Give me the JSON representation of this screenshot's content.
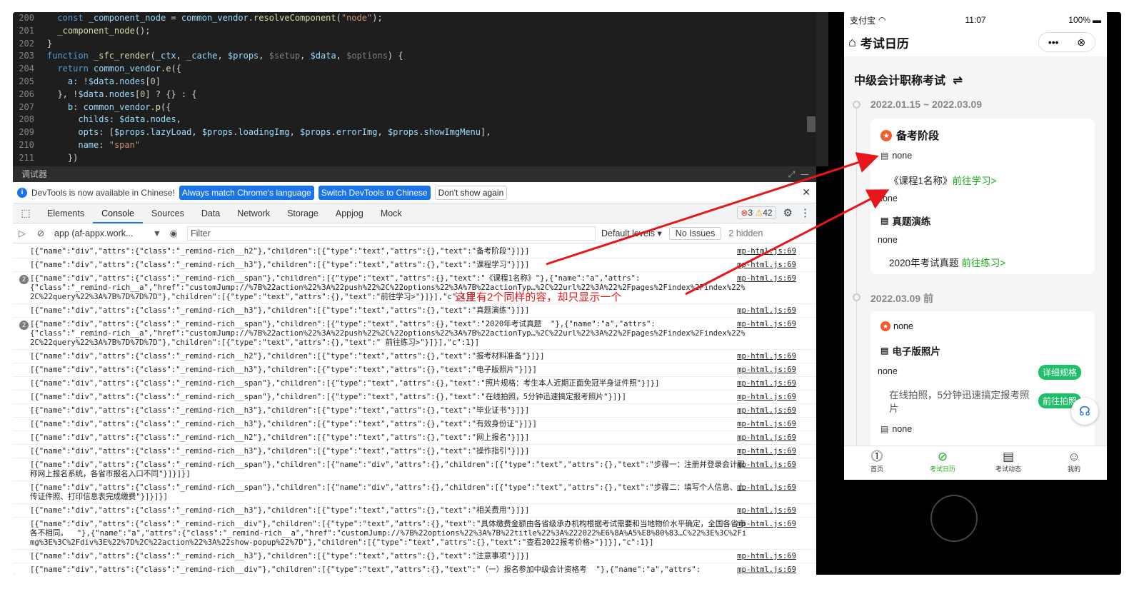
{
  "editor": {
    "lines": [
      {
        "n": "200",
        "html": "  <span class=\"kw\">const</span> <span class=\"var\">_component_node</span> = <span class=\"var\">common_vendor</span>.<span class=\"fn\">resolveComponent</span>(<span class=\"str\">\"node\"</span>);"
      },
      {
        "n": "201",
        "html": "  <span class=\"fn\">_component_node</span>();"
      },
      {
        "n": "202",
        "html": "}"
      },
      {
        "n": "203",
        "html": "<span class=\"kw\">function</span> <span class=\"fn\">_sfc_render</span>(<span class=\"pm\">_ctx</span>, <span class=\"pm\">_cache</span>, <span class=\"pm\">$props</span>, <span class=\"gray\">$setup</span>, <span class=\"pm\">$data</span>, <span class=\"gray\">$options</span>) {"
      },
      {
        "n": "204",
        "html": "  <span class=\"kw\">return</span> <span class=\"var\">common_vendor</span>.<span class=\"fn\">e</span>({"
      },
      {
        "n": "205",
        "html": "    <span class=\"var\">a</span>: !<span class=\"var\">$data</span>.<span class=\"var\">nodes</span>[<span class=\"num\">0</span>]"
      },
      {
        "n": "206",
        "html": "  }, !<span class=\"var\">$data</span>.<span class=\"var\">nodes</span>[<span class=\"num\">0</span>] ? {} : {"
      },
      {
        "n": "207",
        "html": "    <span class=\"var\">b</span>: <span class=\"var\">common_vendor</span>.<span class=\"fn\">p</span>({"
      },
      {
        "n": "208",
        "html": "      <span class=\"var\">childs</span>: <span class=\"var\">$data</span>.<span class=\"var\">nodes</span>,"
      },
      {
        "n": "209",
        "html": "      <span class=\"var\">opts</span>: [<span class=\"var\">$props</span>.<span class=\"var\">lazyLoad</span>, <span class=\"var\">$props</span>.<span class=\"var\">loadingImg</span>, <span class=\"var\">$props</span>.<span class=\"var\">errorImg</span>, <span class=\"var\">$props</span>.<span class=\"var\">showImgMenu</span>],"
      },
      {
        "n": "210",
        "html": "      <span class=\"var\">name</span>: <span class=\"str\">\"span\"</span>"
      },
      {
        "n": "211",
        "html": "    })"
      }
    ]
  },
  "debugger_label": "调试器",
  "devtools": {
    "info_text": "DevTools is now available in Chinese!",
    "btn_match": "Always match Chrome's language",
    "btn_switch": "Switch DevTools to Chinese",
    "btn_dont_show": "Don't show again",
    "tabs": [
      "Elements",
      "Console",
      "Sources",
      "Data",
      "Network",
      "Storage",
      "Appjog",
      "Mock"
    ],
    "errors": "3",
    "warnings": "42",
    "context": "app (af-appx.work...",
    "filter_placeholder": "Filter",
    "levels": "Default levels ▾",
    "no_issues": "No Issues",
    "hidden": "2 hidden"
  },
  "console": {
    "source": "mp-html.js:69",
    "rows": [
      {
        "badge": "",
        "text": "[{\"name\":\"div\",\"attrs\":{\"class\":\"_remind-rich__h2\"},\"children\":[{\"type\":\"text\",\"attrs\":{},\"text\":\"备考阶段\"}]}]"
      },
      {
        "badge": "",
        "text": "[{\"name\":\"div\",\"attrs\":{\"class\":\"_remind-rich__h3\"},\"children\":[{\"type\":\"text\",\"attrs\":{},\"text\":\"课程学习\"}]}]"
      },
      {
        "badge": "2",
        "text": "[{\"name\":\"div\",\"attrs\":{\"class\":\"_remind-rich__span\"},\"children\":[{\"type\":\"text\",\"attrs\":{},\"text\":\"《课程1名称》\"},{\"name\":\"a\",\"attrs\":\n{\"class\":\"_remind-rich__a\",\"href\":\"customJump://%7B%22action%22%3A%22push%22%2C%22options%22%3A%7B%22actionTyp…%2C%22url%22%3A%22%2Fpages%2Findex%2Findex%22%2C%22query%22%3A%7B%7D%7D%7D\"},\"children\":[{\"type\":\"text\",\"attrs\":{},\"text\":\"前往学习>\"}]}],\"c\":1}]"
      },
      {
        "badge": "",
        "text": "[{\"name\":\"div\",\"attrs\":{\"class\":\"_remind-rich__h3\"},\"children\":[{\"type\":\"text\",\"attrs\":{},\"text\":\"真题演练\"}]}]"
      },
      {
        "badge": "2",
        "text": "[{\"name\":\"div\",\"attrs\":{\"class\":\"_remind-rich__span\"},\"children\":[{\"type\":\"text\",\"attrs\":{},\"text\":\"2020年考试真题  \"},{\"name\":\"a\",\"attrs\":\n{\"class\":\"_remind-rich__a\",\"href\":\"customJump://%7B%22action%22%3A%22push%22%2C%22options%22%3A%7B%22actionTyp…%2C%22url%22%3A%22%2Fpages%2Findex%2Findex%22%2C%22query%22%3A%7B%7D%7D%7D\"},\"children\":[{\"type\":\"text\",\"attrs\":{},\"text\":\" 前往练习>\"}]}],\"c\":1}]"
      },
      {
        "badge": "",
        "text": "[{\"name\":\"div\",\"attrs\":{\"class\":\"_remind-rich__h2\"},\"children\":[{\"type\":\"text\",\"attrs\":{},\"text\":\"报考材料准备\"}]}]"
      },
      {
        "badge": "",
        "text": "[{\"name\":\"div\",\"attrs\":{\"class\":\"_remind-rich__h3\"},\"children\":[{\"type\":\"text\",\"attrs\":{},\"text\":\"电子版照片\"}]}]"
      },
      {
        "badge": "",
        "text": "[{\"name\":\"div\",\"attrs\":{\"class\":\"_remind-rich__span\"},\"children\":[{\"type\":\"text\",\"attrs\":{},\"text\":\"照片规格：考生本人近期正面免冠半身证件照\"}]}]"
      },
      {
        "badge": "",
        "text": "[{\"name\":\"div\",\"attrs\":{\"class\":\"_remind-rich__span\"},\"children\":[{\"type\":\"text\",\"attrs\":{},\"text\":\"在线拍照，5分钟迅速搞定报考照片\"}]}]"
      },
      {
        "badge": "",
        "text": "[{\"name\":\"div\",\"attrs\":{\"class\":\"_remind-rich__h3\"},\"children\":[{\"type\":\"text\",\"attrs\":{},\"text\":\"毕业证书\"}]}]"
      },
      {
        "badge": "",
        "text": "[{\"name\":\"div\",\"attrs\":{\"class\":\"_remind-rich__h3\"},\"children\":[{\"type\":\"text\",\"attrs\":{},\"text\":\"有效身份证\"}]}]"
      },
      {
        "badge": "",
        "text": "[{\"name\":\"div\",\"attrs\":{\"class\":\"_remind-rich__h2\"},\"children\":[{\"type\":\"text\",\"attrs\":{},\"text\":\"网上报名\"}]}]"
      },
      {
        "badge": "",
        "text": "[{\"name\":\"div\",\"attrs\":{\"class\":\"_remind-rich__h3\"},\"children\":[{\"type\":\"text\",\"attrs\":{},\"text\":\"操作指引\"}]}]"
      },
      {
        "badge": "",
        "text": "[{\"name\":\"div\",\"attrs\":{\"class\":\"_remind-rich__span\"},\"children\":[{\"name\":\"div\",\"attrs\":{},\"children\":[{\"type\":\"text\",\"attrs\":{},\"text\":\"步骤一：注册并登录会计职称网上报名系统，各省市报名入口不同\"}]}]}]"
      },
      {
        "badge": "",
        "text": "[{\"name\":\"div\",\"attrs\":{\"class\":\"_remind-rich__span\"},\"children\":[{\"name\":\"div\",\"attrs\":{},\"children\":[{\"type\":\"text\",\"attrs\":{},\"text\":\"步骤二：填写个人信息、上传证件照、打印信息表完成缴费\"}]}]}]"
      },
      {
        "badge": "",
        "text": "[{\"name\":\"div\",\"attrs\":{\"class\":\"_remind-rich__h3\"},\"children\":[{\"type\":\"text\",\"attrs\":{},\"text\":\"相关费用\"}]}]"
      },
      {
        "badge": "",
        "text": "[{\"name\":\"div\",\"attrs\":{\"class\":\"_remind-rich__div\"},\"children\":[{\"type\":\"text\",\"attrs\":{},\"text\":\"具体缴费金额由各省级承办机构根据考试需要和当地物价水平确定，全国各省市各不相同。  \"},{\"name\":\"a\",\"attrs\":{\"class\":\"_remind-rich__a\",\"href\":\"customJump://%7B%22options%22%3A%7B%22title%22%3A%222022%E6%8A%A5%E8%80%83…C%22%3E%3C%2Fimg%3E%3C%2Fdiv%3E%22%7D%2C%22action%22%3A%22show-popup%22%7D\"},\"children\":[{\"type\":\"text\",\"attrs\":{},\"text\":\"查看2022报考价格>\"}]}],\"c\":1}]"
      },
      {
        "badge": "",
        "text": "[{\"name\":\"div\",\"attrs\":{\"class\":\"_remind-rich__h3\"},\"children\":[{\"type\":\"text\",\"attrs\":{},\"text\":\"注意事项\"}]}]"
      },
      {
        "badge": "",
        "text": "[{\"name\":\"div\",\"attrs\":{\"class\":\"_remind-rich__div\"},\"children\":[{\"type\":\"text\",\"attrs\":{},\"text\":\"（一）报名参加中级会计资格考  \"},{\"name\":\"a\",\"attrs\":"
      }
    ]
  },
  "annotation": "这里有2个同样的容，却只显示一个",
  "phone": {
    "carrier": "支付宝",
    "time": "11:07",
    "battery": "100%",
    "title": "考试日历",
    "exam_name": "中级会计职称考试",
    "swap_icon": "⇌",
    "range1": "2022.01.15 ~ 2022.03.09",
    "stage1": "备考阶段",
    "none": "none",
    "course": "《课程1名称》",
    "go_study": "前往学习>",
    "practice_title": "真题演练",
    "exam_2020": "2020年考试真题",
    "go_practice": "前往练习>",
    "range2": "2022.03.09 前",
    "photo_title": "电子版照片",
    "detail": "详细规格",
    "photo_text": "在线拍照，5分钟迅速搞定报考照片",
    "photo_btn": "前往拍照",
    "tabs": [
      "首页",
      "考试日历",
      "考试动态",
      "我的"
    ]
  }
}
